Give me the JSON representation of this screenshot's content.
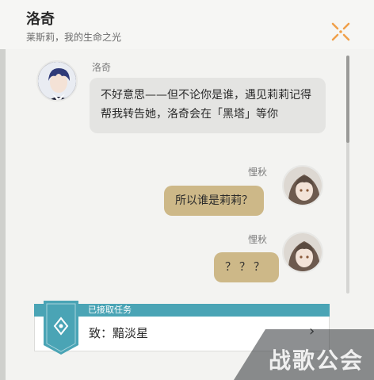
{
  "header": {
    "title": "洛奇",
    "subtitle": "莱斯莉，我的生命之光"
  },
  "messages": [
    {
      "sender": "洛奇",
      "side": "left",
      "text": "不好意思——但不论你是谁，遇见莉莉记得帮我转告她，洛奇会在「黑塔」等你"
    },
    {
      "sender": "悝秋",
      "side": "right",
      "text": "所以谁是莉莉？"
    },
    {
      "sender": "悝秋",
      "side": "right",
      "text": "？？？"
    }
  ],
  "task": {
    "status_label": "已接取任务",
    "name": "致：黯淡星",
    "chevron": "›"
  },
  "watermark": {
    "text": "战歌公会"
  },
  "colors": {
    "task_accent": "#4aa4b5",
    "bubble_player": "#cdb888",
    "close_icon": "#f0a04a"
  }
}
